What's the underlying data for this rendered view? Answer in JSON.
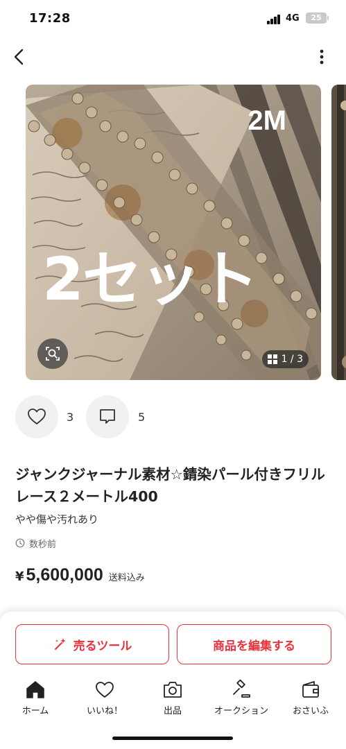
{
  "status_bar": {
    "time": "17:28",
    "network": "4G",
    "battery": "25"
  },
  "nav": {
    "back_icon": "chevron-left-icon",
    "more_icon": "vertical-dots-icon"
  },
  "gallery": {
    "overlay_length": "2M",
    "overlay_sets": "2セット",
    "counter": "1 / 3",
    "zoom_icon": "image-search-icon"
  },
  "social": {
    "likes": "3",
    "comments": "5"
  },
  "item": {
    "title": "ジャンクジャーナル素材☆錆染パール付きフリルレース２メートル400",
    "condition": "やや傷や汚れあり",
    "posted": "数秒前",
    "price_symbol": "¥",
    "price": "5,600,000",
    "shipping": "送料込み"
  },
  "actions": {
    "sell_tool": "売るツール",
    "edit_item": "商品を編集する"
  },
  "tabs": [
    {
      "label": "ホーム",
      "icon": "home-icon"
    },
    {
      "label": "いいね！",
      "icon": "heart-icon"
    },
    {
      "label": "出品",
      "icon": "camera-icon"
    },
    {
      "label": "オークション",
      "icon": "gavel-icon"
    },
    {
      "label": "おさいふ",
      "icon": "wallet-icon"
    }
  ],
  "colors": {
    "accent": "#e8333c",
    "background": "#ffffff",
    "text": "#222222"
  }
}
